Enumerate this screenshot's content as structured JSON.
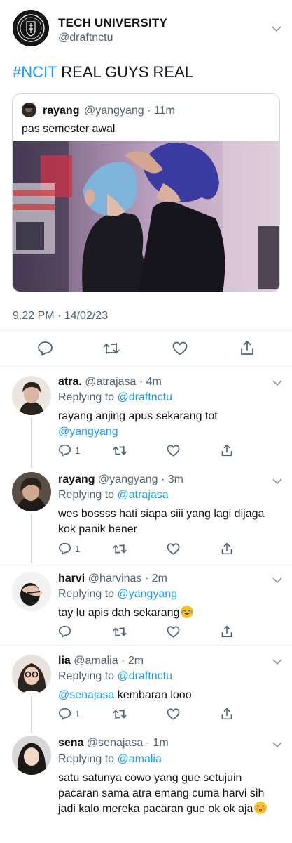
{
  "header": {
    "name": "TECH UNIVERSITY",
    "handle": "@draftnctu",
    "logo_text": "NCTU"
  },
  "tweet": {
    "hashtag": "#NCIT",
    "text": " REAL GUYS REAL",
    "timestamp": "9.22 PM · 14/02/23"
  },
  "quote": {
    "name": "rayang",
    "handle_time": "@yangyang · 11m",
    "text": "pas semester awal",
    "image_label": "photo of two people"
  },
  "actions": {
    "reply_icon": "comment-icon",
    "retweet_icon": "retweet-icon",
    "like_icon": "heart-icon",
    "share_icon": "share-icon"
  },
  "replies": [
    {
      "name": "atra.",
      "meta": "@atrajasa · 4m",
      "replying_prefix": "Replying to ",
      "replying_to": "@draftnctu",
      "body_line1": "rayang anjing apus sekarang tot",
      "body_mention": "@yangyang",
      "reply_count": "1"
    },
    {
      "name": "rayang",
      "meta": "@yangyang · 3m",
      "replying_prefix": "Replying to ",
      "replying_to": "@atrajasa",
      "body_line1": "wes bossss hati siapa siii yang lagi dijaga",
      "body_line2": "kok panik bener",
      "reply_count": "1"
    },
    {
      "name": "harvi",
      "meta": "@harvinas · 2m",
      "replying_prefix": "Replying to ",
      "replying_to": "@yangyang",
      "body_line1": "tay lu apis dah sekarang",
      "reply_count": ""
    },
    {
      "name": "lia",
      "meta": "@amalia · 2m",
      "replying_prefix": "Replying to ",
      "replying_to": "@draftnctu",
      "body_mention": "@senajasa",
      "body_line1": " kembaran looo",
      "reply_count": "1"
    },
    {
      "name": "sena",
      "meta": "@senajasa · 1m",
      "replying_prefix": "Replying to ",
      "replying_to": "@amalia",
      "body_line1": "satu satunya cowo yang gue setujuin",
      "body_line2": "pacaran sama atra emang cuma harvi sih",
      "body_line3": "jadi kalo mereka pacaran gue ok ok aja"
    }
  ],
  "colors": {
    "link": "#1d9bf0",
    "secondary_text": "#536471",
    "border": "#cfd9de"
  }
}
